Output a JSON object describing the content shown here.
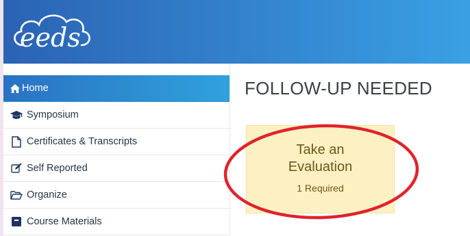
{
  "header": {
    "logo_text": "eeds",
    "logo_icon": "cloud-logo"
  },
  "sidebar": {
    "items": [
      {
        "label": "Home",
        "icon": "home-icon",
        "active": true
      },
      {
        "label": "Symposium",
        "icon": "graduation-cap-icon"
      },
      {
        "label": "Certificates & Transcripts",
        "icon": "document-icon"
      },
      {
        "label": "Self Reported",
        "icon": "edit-icon"
      },
      {
        "label": "Organize",
        "icon": "folder-open-icon"
      },
      {
        "label": "Course Materials",
        "icon": "materials-icon"
      }
    ]
  },
  "main": {
    "title": "FOLLOW-UP NEEDED",
    "card": {
      "title_line1": "Take an",
      "title_line2": "Evaluation",
      "required": "1 Required"
    }
  },
  "colors": {
    "header_start": "#2b63b4",
    "header_end": "#3aa0e4",
    "active_nav": "#2fa2dc",
    "card_bg": "#fdf1c4",
    "card_text": "#6d5617",
    "highlight_circle": "#e0242b"
  }
}
